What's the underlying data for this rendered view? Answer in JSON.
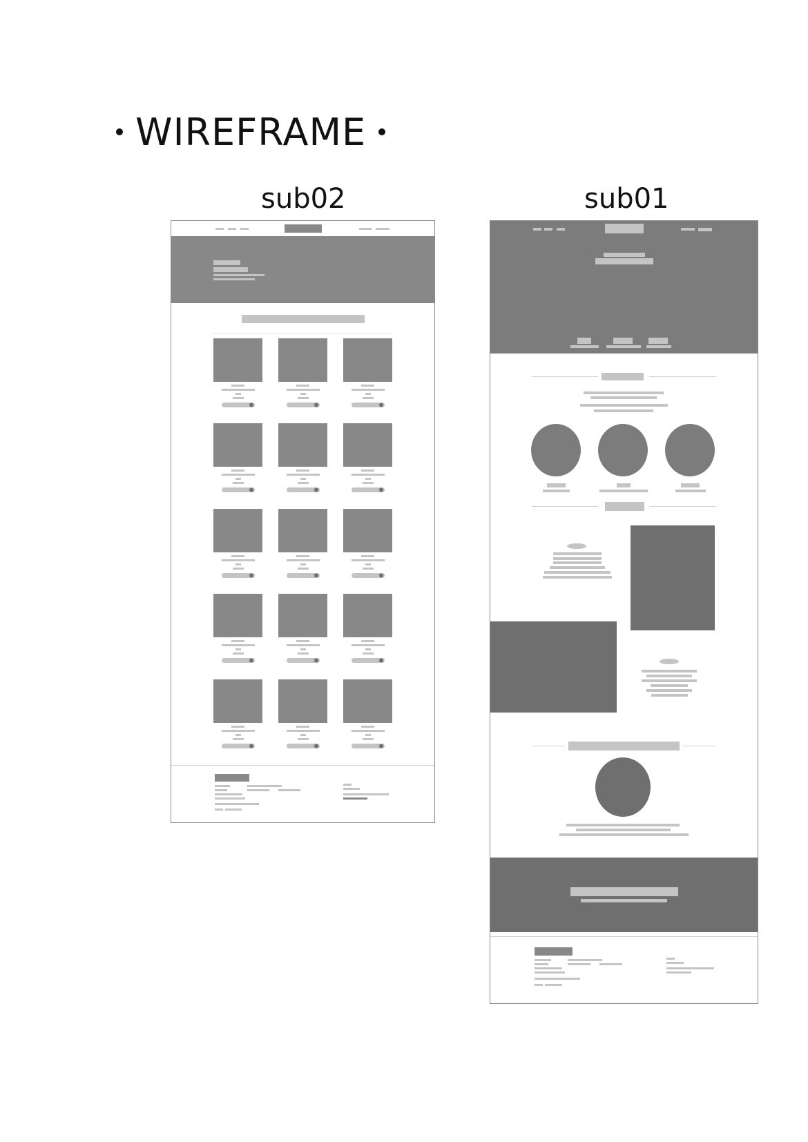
{
  "title": "WIREFRAME",
  "frames": [
    {
      "label": "sub02",
      "sections": [
        "nav",
        "hero",
        "filter-bar",
        "product-grid",
        "footer"
      ],
      "grid": {
        "columns": 3,
        "rows": 5
      }
    },
    {
      "label": "sub01",
      "sections": [
        "hero",
        "feature-circles",
        "split-content",
        "profile",
        "cta-banner",
        "footer"
      ],
      "feature_circles": 3
    }
  ],
  "colors": {
    "dark": "#6f6f6f",
    "medium": "#888888",
    "light": "#c4c4c4",
    "line": "#d2d2d2",
    "border": "#8a8a8a"
  }
}
